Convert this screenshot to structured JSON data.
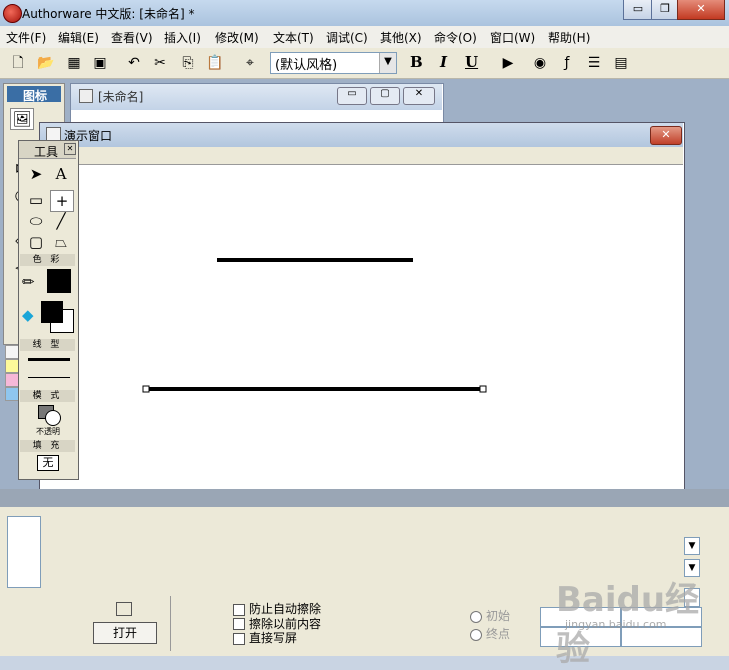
{
  "app": {
    "title": "Authorware 中文版: [未命名] *"
  },
  "menu": [
    "文件(F)",
    "编辑(E)",
    "查看(V)",
    "插入(I)",
    "修改(M)",
    "文本(T)",
    "调试(C)",
    "其他(X)",
    "命令(O)",
    "窗口(W)",
    "帮助(H)"
  ],
  "toolbar": {
    "style_select": "(默认风格)",
    "bold": "B",
    "italic": "I",
    "underline": "U"
  },
  "icon_palette": {
    "title": "图标"
  },
  "flow_window": {
    "title": "[未命名]"
  },
  "presentation": {
    "title": "演示窗口"
  },
  "tools": {
    "title": "工具",
    "color_label": "色 彩",
    "line_label": "线 型",
    "mode_label": "模 式",
    "mode_value": "不透明",
    "fill_label": "填 充",
    "fill_value": "无",
    "text_tool": "A"
  },
  "bottom": {
    "open_button": "打开",
    "checkbox_1": "防止自动擦除",
    "checkbox_2": "擦除以前内容",
    "checkbox_3": "直接写屏",
    "radio_1": "初始",
    "radio_2": "终点"
  },
  "watermark": {
    "text": "Baidu经验",
    "sub": "jingyan.baidu.com"
  }
}
